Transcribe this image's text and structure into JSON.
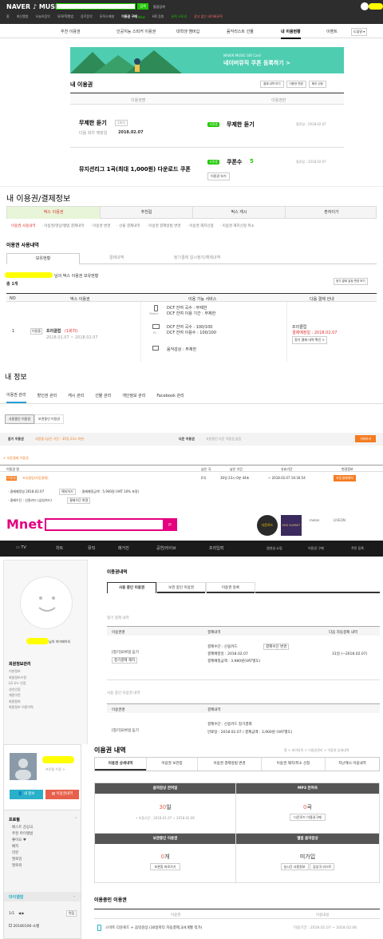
{
  "naver": {
    "logo": "NAVER ♪ MUSIC",
    "search_btn": "검색",
    "top_links": [
      "통합검색"
    ],
    "gnb": [
      "홈",
      "최신앨범",
      "오늘의음악",
      "뮤직PD앨범",
      "장르음악",
      "뮤직스페셜",
      "이용권 구매",
      "HD 음원",
      "뮤직 스토리",
      "광고 없는 네이버뮤직"
    ],
    "new_badge": "New",
    "tabs": [
      "추천 이용권",
      "인공지능 스피커 이용권",
      "대학생 멤버십",
      "음악리스트 선물",
      "내 이용현황",
      "이벤트"
    ],
    "tab_right": "도움말 ▾",
    "banner_small": "NAVER MUSIC Gift Card",
    "banner_text": "네이버뮤직 쿠폰 등록하기 >",
    "section_title": "내 이용권",
    "section_btns": [
      "결제 내역 보기",
      "이용권 변경",
      "해지 신청"
    ],
    "col_headers": [
      "이용권명",
      "이용권한"
    ],
    "items": [
      {
        "name": "무제한 듣기",
        "badge": "1회차",
        "sub_label": "다음 회차 예정일",
        "sub_value": "2018.02.07",
        "tag": "사용중",
        "right": "무제한 듣기",
        "date": "종료일 : 2018.02.07"
      },
      {
        "name": "뮤지션리그 1곡(최대 1,000원) 다운로드 쿠폰",
        "tag": "사용중",
        "right": "쿠폰수",
        "right_count": "5",
        "btn": "이용권 보기",
        "date": "종료일 : 2018.02.07"
      }
    ]
  },
  "bugs": {
    "title": "내 이용권/결제정보",
    "tabs": [
      "벅스 이용권",
      "추천컵",
      "벅스 캐시",
      "혼자이기"
    ],
    "subtabs": [
      "이용권 사용내역",
      "· 이용권/영상/앨범 결제내역",
      "· 이용권 변경",
      "· 선물 결제내역",
      "· 이용권 결제방법 변경",
      "· 이용권 해지신청",
      "· 이용권 해지신청 취소"
    ],
    "section": "이용권 사용내역",
    "inner_tabs": [
      "보유현황",
      "결제내역",
      "정기결제 일시정지/해제내역"
    ],
    "owner_suffix": "님의 벅스 이용권 보유현황",
    "count": "총 1개",
    "notice_btn": "정기 결제 일정 변경 보기",
    "headers": [
      "NO",
      "벅스 이용권",
      "이용 가능 서비스",
      "다음 결제 안내"
    ],
    "row": {
      "no": "1",
      "type": "이용중",
      "name": "프리클럽",
      "name_note": "(1회차)",
      "period": "2018.01.07 ~ 2018.02.07",
      "mobile_label": "Mobile",
      "pc_label": "PC",
      "svc": [
        "DCF 잔여 곡수 : 무제한",
        "DCF 잔여 이용 기간 : 무제한",
        "DCF 잔여 곡수 : 100/100",
        "DCF 잔여 이용수 : 100/100",
        "음악감상 : 무제한"
      ],
      "next_name": "프리클럽",
      "next_label": "결제예정일 : 2018.02.07",
      "next_btn": "정기 결제 내역 확인 >"
    }
  },
  "genie": {
    "title": "내 정보",
    "tabs": [
      "이용권 관리",
      "할인권 관리",
      "캐시 관리",
      "선물 관리",
      "개인정보 관리",
      "Facebook 관리"
    ],
    "subtabs": [
      "사용중인 이용권",
      "보관중인 이용권"
    ],
    "bar_label": "듣기 이용권",
    "bar_value": "사용중 (남은 기간 : 30일 23시 0분)",
    "bar2_label": "다운 이용권",
    "bar2_value": "사용중인 다운 이용권 없음",
    "buy_btn": "구매하기",
    "sub_section": "✔ 자동결제 이용권",
    "headers": [
      "이용권 명",
      "남은 곡",
      "남은 기간",
      "유효기간",
      "변경정보"
    ],
    "row": {
      "tag": "이용중",
      "name": "프리클럽(자동결제)",
      "songs": "0곡",
      "remain": "30일 23시 0분 44초",
      "valid": "~ 2018.02.07 16:30:54",
      "change": "자동결제해지"
    },
    "pay": [
      "· 결제예정일 2018.02.07",
      "해지하기",
      "· 결제예정금액 : 5,940원 (VAT 10% 포함)",
      "· 결제수단 : 신용카드 (삼성카드)",
      "결제수단 변경"
    ]
  },
  "mnet": {
    "logo": "Mnet",
    "promo": [
      "다운로드",
      "EMS SUMMIT",
      "melon",
      "LIVEON"
    ],
    "nav": [
      "TV",
      "차트",
      "뮤직",
      "매거진",
      "공연/라이브",
      "프리입력"
    ],
    "nav_right": [
      "엠넷샵 쇼핑",
      "이용권 구매",
      "쿠폰 등록"
    ],
    "mypage": "님의 마이페이지",
    "side_title": "회원정보관리",
    "side_items": [
      "기본정보",
      "회원정보수정",
      "LG U+ 인증",
      "성인인증",
      "계정이전",
      "회원탈퇴",
      "회원정보 이용이력"
    ],
    "content_title": "이용권내역",
    "tabs": [
      "사용 중인 이용권",
      "보관 중인 이용권",
      "이용권 등록"
    ],
    "sec1": "정기 결제 내역",
    "h1": [
      "이용권명",
      "결제내역",
      "다음 자동결제 내역"
    ],
    "r1": {
      "name": "[정기]모바일 듣기",
      "btn": "정기결제 해지",
      "pay1": "결제수단 : 신용카드",
      "pay_btn": "결제수단 변경",
      "pay2": "결제예정일 : 2018.02.07",
      "pay3": "결제예정금액 : 3,980원(VAT별도)",
      "next": "31일 (~2018.02.07)"
    },
    "sec2": "사용 중인 이용권 내역",
    "h2": [
      "이용권명",
      "결제내역"
    ],
    "r2": {
      "name": "[정기]모바일 듣기",
      "pay1": "결제수단 : 신용카드 정기결제",
      "pay2": "만료일 : 2018.02.07 / 결제금액 : 3,900원 (VAT별도)"
    }
  },
  "soribada": {
    "profile_btn": "프로필 수정 >",
    "btn_info": "내 정보",
    "btn_pass": "이용권내역",
    "menu_title": "프로필",
    "menu_items": [
      "베스트 감상곡",
      "추천 마이앨범",
      "좋아요 ♥",
      "배지",
      "리뷰",
      "팔로잉",
      "팔로워"
    ],
    "album_title": "마이앨범",
    "page": "1/1",
    "edit": "편집",
    "album_item": "20180106-소팽",
    "title": "이용권 내역",
    "breadcrumb": "홈 > 마이뮤직 > 이용권관리 > 이용권 상세내역",
    "tabs": [
      "이용권 상세내역",
      "이용권 보관함",
      "이용권 결제방법 변경",
      "이용권 해지/취소 신청",
      "지난캐시 이용내역"
    ],
    "box1": {
      "head": "음악감상 잔여일",
      "val": "30",
      "unit": "일",
      "sub": "• 이용기간 : 2018.01.07 ~ 2018.02.06"
    },
    "box2": {
      "head": "MP3 잔여곡",
      "val": "0",
      "unit": "곡",
      "btn": "다운로드 이용권구매"
    },
    "box3": {
      "head": "보관중인 이용권",
      "val": "0",
      "unit": "개",
      "btn": "보관함 바로가기"
    },
    "box4": {
      "head": "앨범 음악감상",
      "val": "미가입",
      "btns": [
        "실시간 사용정보",
        "감상곡 리스트"
      ]
    },
    "sec": "이용중인 이용권",
    "h": [
      "이용권",
      "이용내용"
    ],
    "row": {
      "name": "스마트 다운로드 + 음악감상 (30일마다 자동결제,3/4개월 적가)",
      "period": "이용기간 : 2018.01.07 ~ 2018.02.06"
    }
  },
  "colors": {
    "naver_green": "#1ec800",
    "naver_bar": "#2d2d2d",
    "bugs_red": "#e03030",
    "mnet_magenta": "#e4007f",
    "mnet_nav": "#1a1a1a",
    "soribada_dark": "#555555",
    "orange": "#f47b20"
  }
}
